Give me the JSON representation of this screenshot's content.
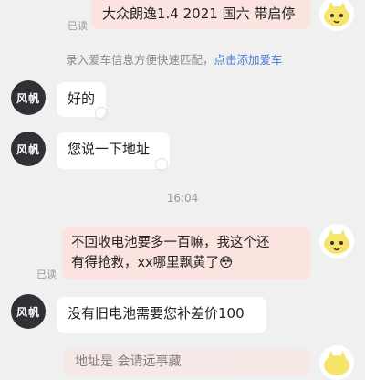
{
  "messages": {
    "car_info": "大众朗逸1.4 2021 国六 带启停",
    "read_1": "已读",
    "tip_text": "录入爱车信息方便快速匹配，",
    "tip_link": "点击添加爱车",
    "reply_ok": "好的",
    "ask_address": "您说一下地址",
    "time_label": "16:04",
    "complaint_line1": "不回收电池要多一百嘛，我这个还",
    "complaint_line2": "有得抢救，xx哪里飘黄了😳",
    "read_2": "已读",
    "price_diff": "没有旧电池需要您补差价100",
    "partial_text": "地址是 会请远事藏"
  },
  "user_avatar_label": "风帆",
  "colors": {
    "background": "#f0f0f0",
    "outgoing_bubble": "#fbe3df",
    "incoming_bubble": "#ffffff",
    "link": "#4a7bd6",
    "avatar_dark": "#2f3136"
  },
  "icons": {
    "self_avatar": "yellow-cartoon-character",
    "read_stamp": "red-seal-mark"
  }
}
